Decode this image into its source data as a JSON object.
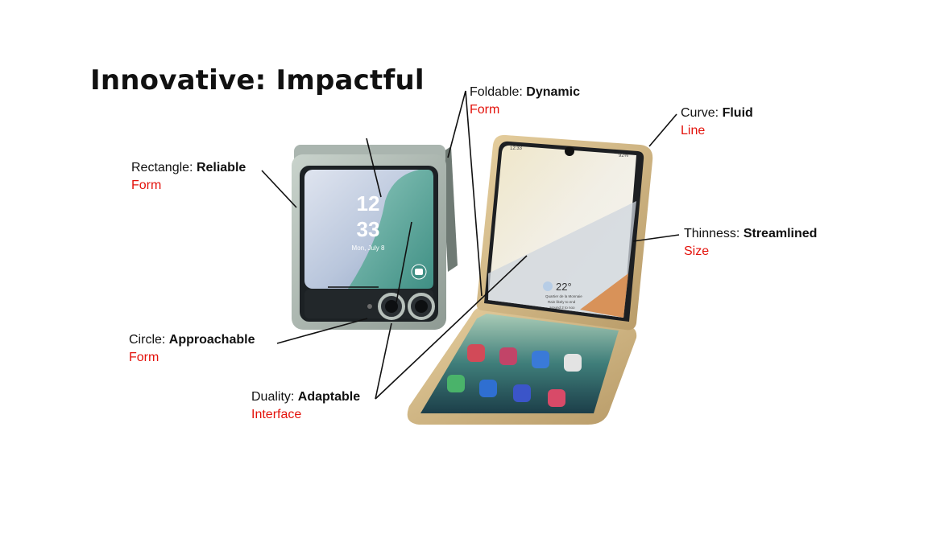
{
  "title": "Innovative: Impactful",
  "labels": {
    "foldable": {
      "prefix": "Foldable: ",
      "emphasis": "Dynamic",
      "sub": "Form"
    },
    "curve": {
      "prefix": "Curve: ",
      "emphasis": "Fluid",
      "sub": "Line"
    },
    "rectangle": {
      "prefix": "Rectangle: ",
      "emphasis": "Reliable",
      "sub": "Form"
    },
    "thinness": {
      "prefix": "Thinness: ",
      "emphasis": "Streamlined",
      "sub": "Size"
    },
    "circle": {
      "prefix": "Circle: ",
      "emphasis": "Approachable",
      "sub": "Form"
    },
    "duality": {
      "prefix": "Duality: ",
      "emphasis": "Adaptable",
      "sub": "Interface"
    }
  },
  "closed_phone": {
    "hour": "12",
    "minute": "33",
    "date": "Mon, July 8"
  },
  "open_phone": {
    "status_time": "12:33",
    "status_battery": "92%",
    "temperature": "22°",
    "weather_line1": "Quartier de la Monnaie",
    "weather_line2": "Rain likely to end",
    "weather_line3": "around 2 to noo"
  },
  "colors": {
    "accent_red": "#e3120b",
    "leader_line": "#111111"
  }
}
